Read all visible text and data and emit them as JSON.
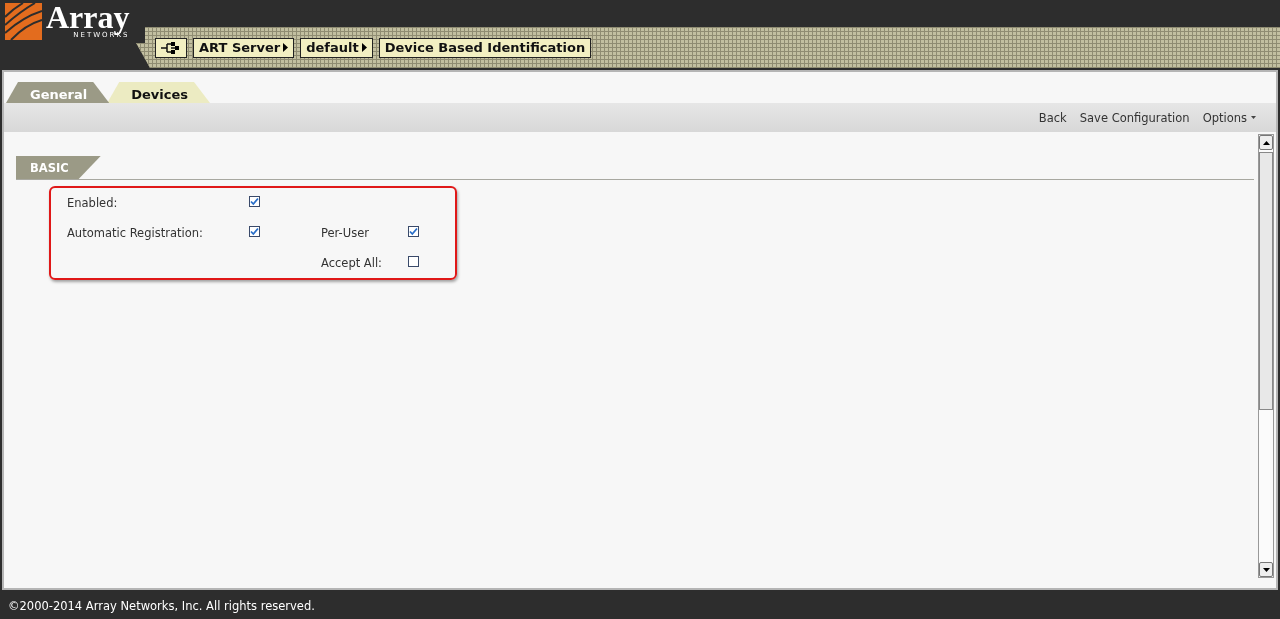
{
  "logo": {
    "name": "Array",
    "tagline": "NETWORKS"
  },
  "breadcrumbs": [
    {
      "label": "ART Server",
      "arrow": true
    },
    {
      "label": "default",
      "arrow": true
    },
    {
      "label": "Device Based Identification",
      "arrow": false
    }
  ],
  "tabs": [
    {
      "label": "General",
      "selected": true
    },
    {
      "label": "Devices",
      "selected": false
    }
  ],
  "toolbar": {
    "links": [
      "Back",
      "Save Configuration"
    ],
    "menu": "Options"
  },
  "section": {
    "title": "BASIC",
    "highlighted": true,
    "rows": [
      {
        "left": {
          "label": "Enabled:",
          "checked": true
        }
      },
      {
        "left": {
          "label": "Automatic Registration:",
          "checked": true
        },
        "right": {
          "label": "Per-User",
          "checked": true
        }
      },
      {
        "right": {
          "label": "Accept All:",
          "checked": false
        }
      }
    ]
  },
  "footer": "©2000-2014 Array Networks, Inc. All rights reserved."
}
